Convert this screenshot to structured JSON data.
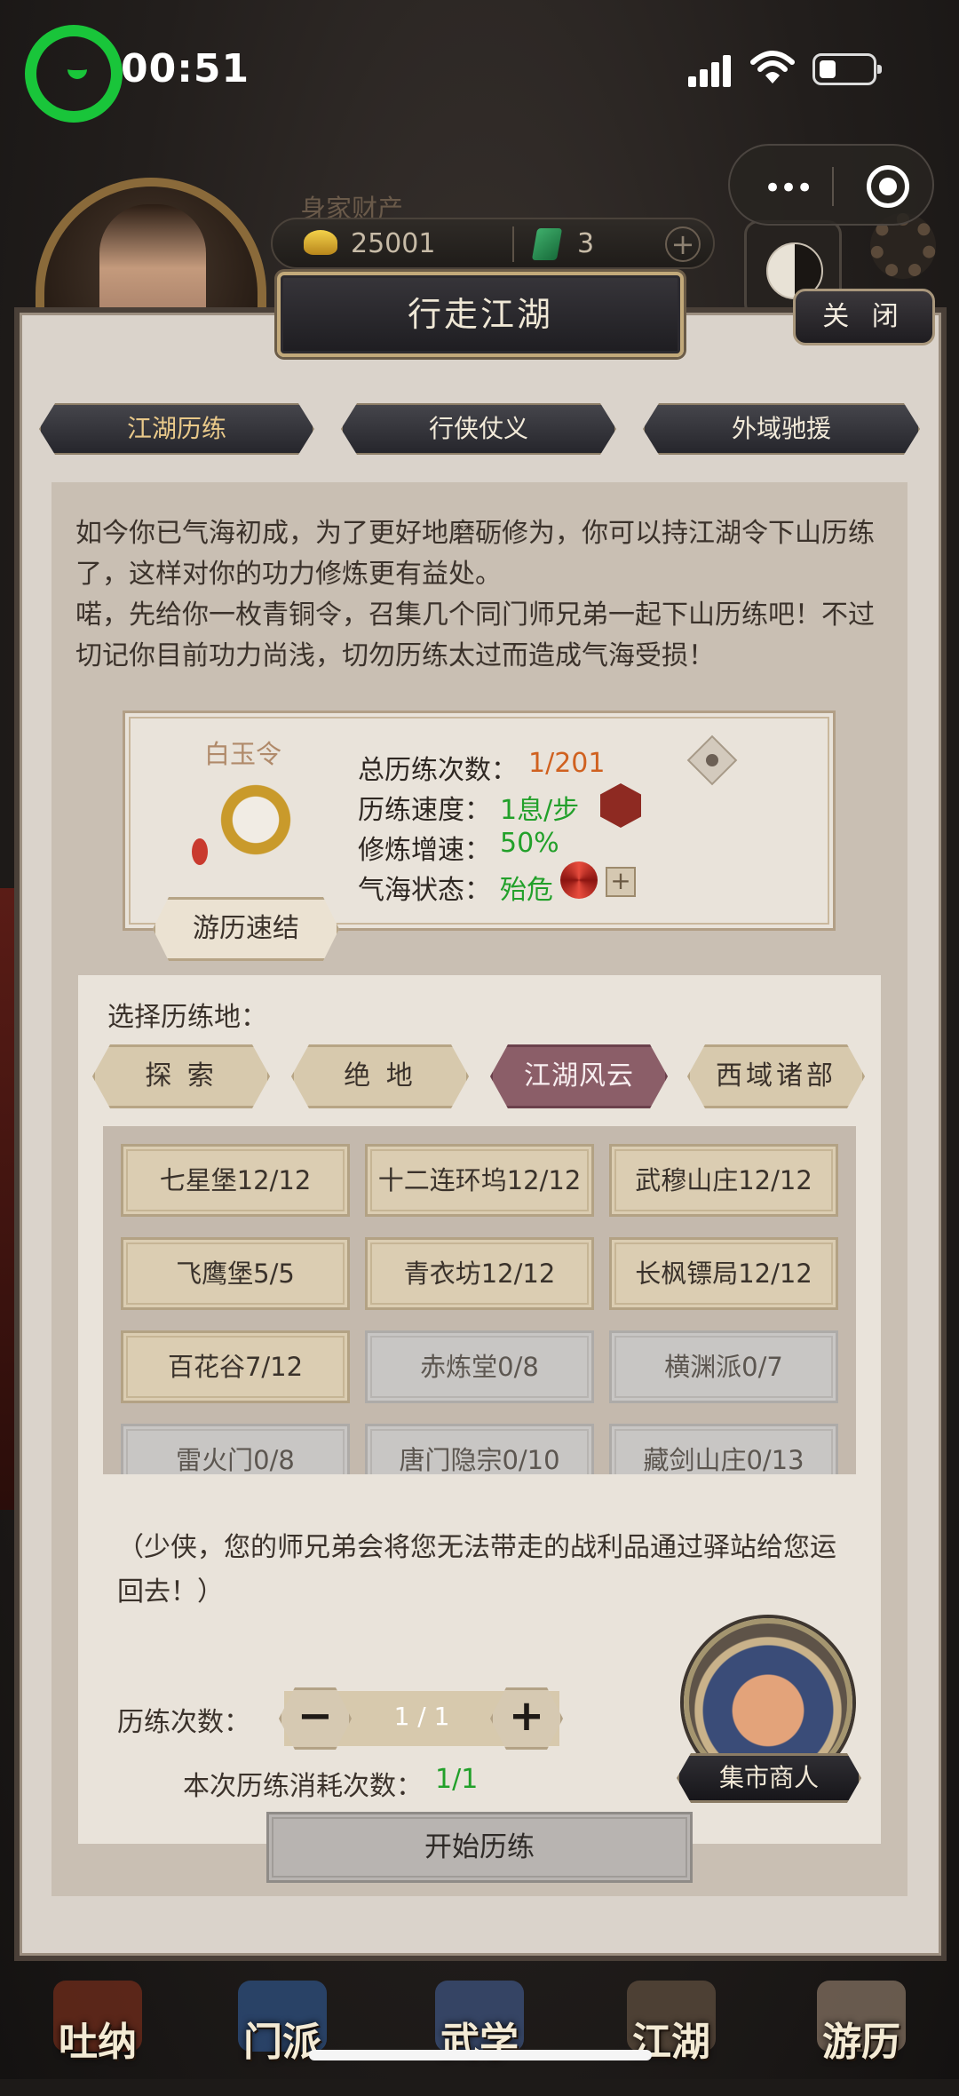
{
  "status_bar": {
    "time": "00:51"
  },
  "hud": {
    "wealth_label": "身家财产",
    "gold": "25001",
    "jade": "3"
  },
  "modal": {
    "title": "行走江湖",
    "close_label": "关 闭",
    "tabs": [
      "江湖历练",
      "行侠仗义",
      "外域驰援"
    ],
    "intro_lines": [
      "如今你已气海初成，为了更好地磨砺修为，你可以持江湖令下山历练了，这样对你的功力修炼更有益处。",
      "喏，先给你一枚青铜令，召集几个同门师兄弟一起下山历练吧！不过切记你目前功力尚浅，切勿历练太过而造成气海受损！"
    ],
    "token": {
      "name": "白玉令",
      "stats": [
        {
          "label": "总历练次数：",
          "value": "1/201"
        },
        {
          "label": "历练速度：",
          "value": "1息/步"
        },
        {
          "label": "修炼增速：",
          "value": "50%"
        },
        {
          "label": "气海状态：",
          "value": "殆危"
        }
      ],
      "quick_button": "游历速结"
    },
    "select_label": "选择历练地：",
    "regions": [
      "探 索",
      "绝 地",
      "江湖风云",
      "西域诸部"
    ],
    "locations": [
      [
        "七星堡12/12",
        "十二连环坞12/12",
        "武穆山庄12/12"
      ],
      [
        "飞鹰堡5/5",
        "青衣坊12/12",
        "长枫镖局12/12"
      ],
      [
        "百花谷7/12",
        "赤炼堂0/8",
        "横渊派0/7"
      ],
      [
        "雷火门0/8",
        "唐门隐宗0/10",
        "藏剑山庄0/13"
      ]
    ],
    "loot_note": "（少侠，您的师兄弟会将您无法带走的战利品通过驿站给您运回去！）",
    "count_label": "历练次数：",
    "count_value": "1 / 1",
    "minus": "−",
    "plus": "+",
    "cost_label": "本次历练消耗次数：",
    "cost_value": "1/1",
    "start_button": "开始历练",
    "merchant_label": "集市商人"
  },
  "bottom_nav": [
    "吐纳",
    "门派",
    "武学",
    "江湖",
    "游历"
  ],
  "colors": {
    "orange_value": "#d0611f",
    "green_value": "#22a02a",
    "active_region": "#8b5e68"
  }
}
